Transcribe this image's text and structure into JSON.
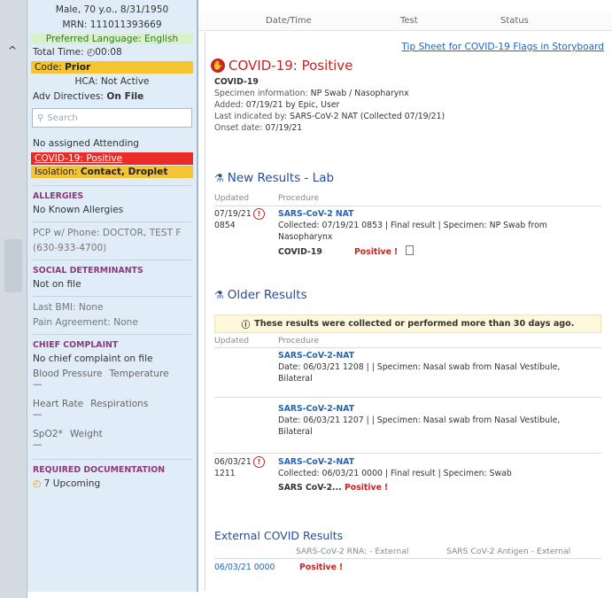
{
  "patient": {
    "demographics": "Male, 70 y.o., 8/31/1950",
    "mrn": "MRN: 111011393669",
    "language": "Preferred Language: English",
    "total_time_label": "Total Time:",
    "total_time_value": "00:08",
    "code_label": "Code:",
    "code_value": "Prior",
    "hca": "HCA: Not Active",
    "adv_label": "Adv Directives:",
    "adv_value": "On File",
    "search_placeholder": "Search",
    "attending": "No assigned Attending",
    "covid_flag": "COVID-19: Positive",
    "isolation_label": "Isolation:",
    "isolation_value": "Contact, Droplet"
  },
  "sidebar": {
    "allergies_head": "ALLERGIES",
    "allergies_value": "No Known Allergies",
    "pcp_line1": "PCP w/ Phone: DOCTOR, TEST F",
    "pcp_line2": "(630-933-4700)",
    "sdoh_head": "SOCIAL DETERMINANTS",
    "sdoh_value": "Not on file",
    "bmi": "Last BMI: None",
    "pain": "Pain Agreement: None",
    "cc_head": "CHIEF COMPLAINT",
    "cc_value": "No chief complaint on file",
    "vitals": {
      "bp": "Blood Pressure",
      "temp": "Temperature",
      "hr": "Heart Rate",
      "resp": "Respirations",
      "spo2": "SpO2*",
      "weight": "Weight"
    },
    "vital_empty": "—",
    "req_head": "REQUIRED DOCUMENTATION",
    "req_value": "7 Upcoming"
  },
  "header_cols": {
    "datetime": "Date/Time",
    "test": "Test",
    "status": "Status"
  },
  "main": {
    "tip_link": "Tip Sheet for COVID-19 Flags in Storyboard",
    "flag_title": "COVID-19: Positive",
    "flag_name": "COVID-19",
    "specimen_label": "Specimen information:",
    "specimen_value": "NP Swab / Nasopharynx",
    "added_label": "Added:",
    "added_value": "07/19/21 by Epic, User",
    "last_label": "Last indicated by:",
    "last_value": "SARS-CoV-2 NAT (Collected 07/19/21)",
    "onset_label": "Onset date:",
    "onset_value": "07/19/21",
    "new_results_title": "New Results - Lab",
    "col_updated": "Updated",
    "col_procedure": "Procedure",
    "new_result": {
      "date": "07/19/21",
      "time": "0854",
      "proc": "SARS-CoV-2 NAT",
      "detail1": "Collected: 07/19/21 0853 | Final result | Specimen: NP Swab from",
      "detail2": "Nasopharynx",
      "component": "COVID-19",
      "result": "Positive"
    },
    "older_title": "Older Results",
    "older_notice": "These results were collected or performed more than 30 days ago.",
    "older": [
      {
        "proc": "SARS-CoV-2-NAT",
        "detail1": "Date: 06/03/21 1208 | | Specimen: Nasal swab from Nasal Vestibule,",
        "detail2": "Bilateral"
      },
      {
        "proc": "SARS-CoV-2-NAT",
        "detail1": "Date: 06/03/21 1207 | | Specimen: Nasal swab from Nasal Vestibule,",
        "detail2": "Bilateral"
      },
      {
        "date": "06/03/21",
        "time": "1211",
        "proc": "SARS-CoV-2-NAT",
        "detail1": "Collected: 06/03/21 0000 | Final result | Specimen: Swab",
        "component": "SARS CoV-2...",
        "result": "Positive"
      }
    ],
    "external_title": "External COVID Results",
    "ext_col1": "SARS-CoV-2 RNA: - External",
    "ext_col2": "SARS CoV-2 Antigen - External",
    "ext_date": "06/03/21 0000",
    "ext_result": "Positive",
    "exclaim": "!"
  },
  "colors": {
    "code_yellow": "#f6c331",
    "covid_red": "#ea2b27",
    "language_green": "#d9f1c9",
    "link_blue": "#2266bb",
    "section_purple": "#8b3a7c"
  },
  "icons": [
    "chevron-up-icon",
    "clock-icon",
    "search-icon",
    "stop-hand-icon",
    "flask-icon",
    "alert-circle-icon",
    "info-icon",
    "document-icon"
  ]
}
